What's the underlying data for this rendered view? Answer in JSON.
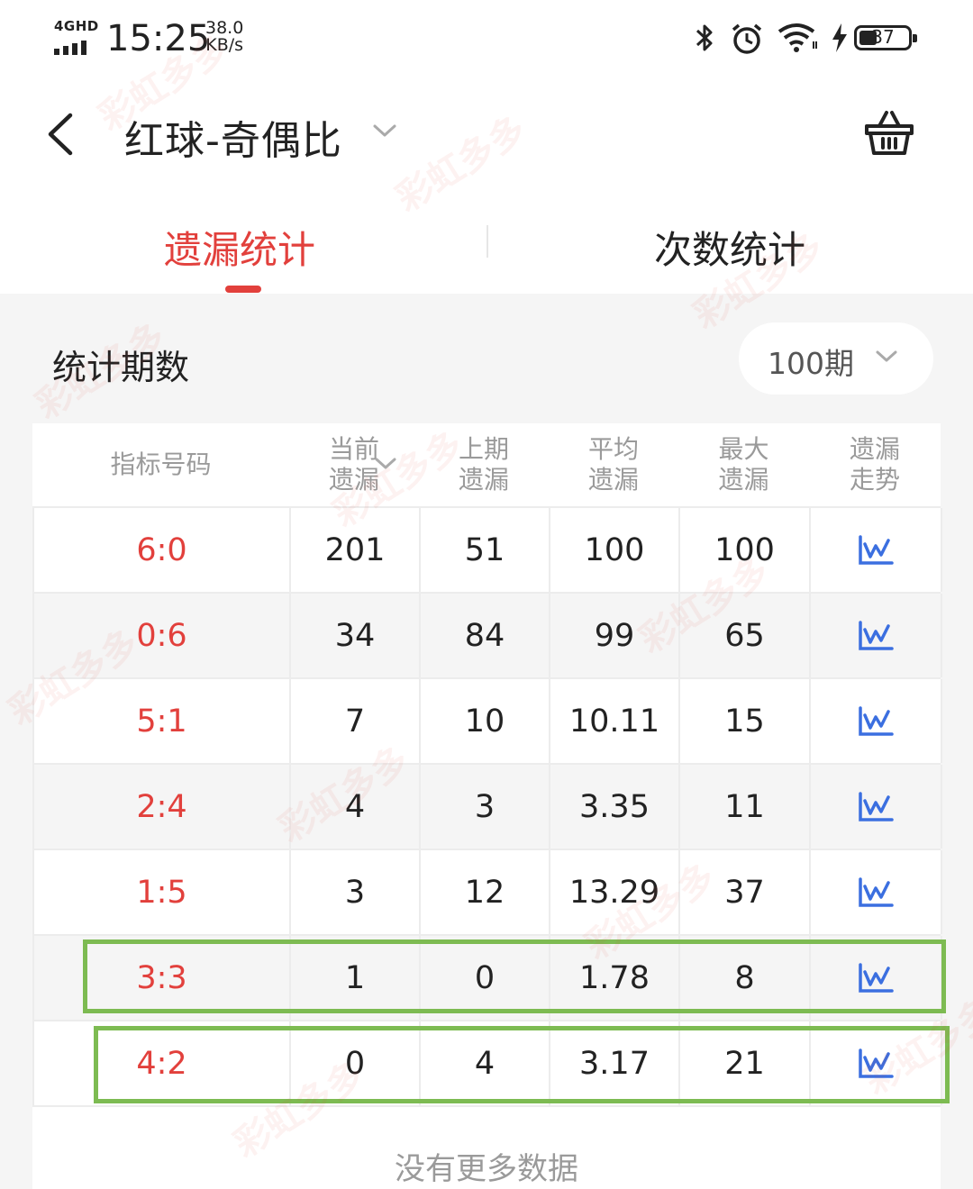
{
  "status_bar": {
    "network": "4GHD",
    "time": "15:25",
    "speed_value": "38.0",
    "speed_unit": "KB/s",
    "battery": "37",
    "battery_level": 0.37,
    "icons": [
      "bluetooth-icon",
      "alarm-icon",
      "wifi-icon",
      "charging-icon",
      "battery-icon"
    ]
  },
  "header": {
    "title": "红球-奇偶比",
    "back_icon": "chevron-left-icon",
    "title_dropdown_icon": "chevron-down-icon",
    "basket_icon": "basket-icon"
  },
  "tabs": [
    {
      "label": "遗漏统计",
      "active": true
    },
    {
      "label": "次数统计",
      "active": false
    }
  ],
  "period": {
    "label": "统计期数",
    "value": "100期"
  },
  "table": {
    "headers": [
      {
        "line1": "指标号码",
        "line2": ""
      },
      {
        "line1": "当前",
        "line2": "遗漏"
      },
      {
        "line1": "上期",
        "line2": "遗漏"
      },
      {
        "line1": "平均",
        "line2": "遗漏"
      },
      {
        "line1": "最大",
        "line2": "遗漏"
      },
      {
        "line1": "遗漏",
        "line2": "走势"
      }
    ],
    "rows": [
      {
        "code": "6:0",
        "current": "201",
        "last": "51",
        "avg": "100",
        "max": "100"
      },
      {
        "code": "0:6",
        "current": "34",
        "last": "84",
        "avg": "99",
        "max": "65"
      },
      {
        "code": "5:1",
        "current": "7",
        "last": "10",
        "avg": "10.11",
        "max": "15"
      },
      {
        "code": "2:4",
        "current": "4",
        "last": "3",
        "avg": "3.35",
        "max": "11"
      },
      {
        "code": "1:5",
        "current": "3",
        "last": "12",
        "avg": "13.29",
        "max": "37"
      },
      {
        "code": "3:3",
        "current": "1",
        "last": "0",
        "avg": "1.78",
        "max": "8"
      },
      {
        "code": "4:2",
        "current": "0",
        "last": "4",
        "avg": "3.17",
        "max": "21"
      }
    ],
    "trend_icon": "trend-chart-icon"
  },
  "footer": {
    "no_more": "没有更多数据"
  },
  "watermark": "彩虹多多",
  "colors": {
    "accent": "#e2403c",
    "highlight": "#7dbb52",
    "trend_icon": "#3b6fe0",
    "background": "#f5f5f5"
  }
}
